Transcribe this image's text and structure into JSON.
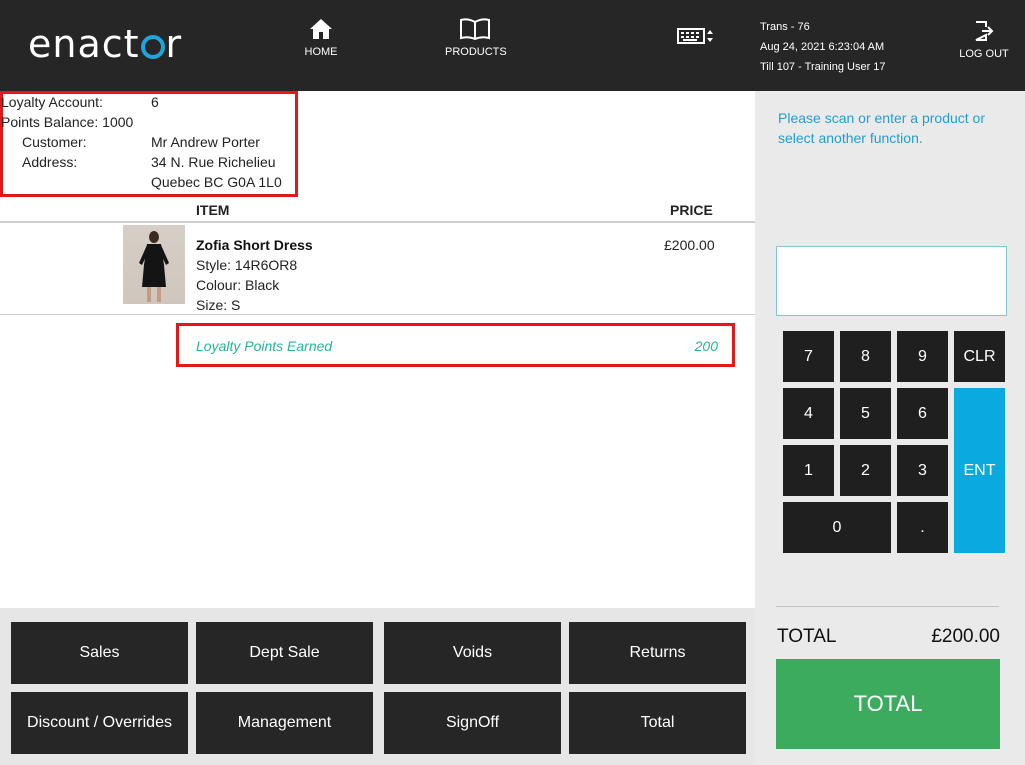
{
  "header": {
    "logo": "enactor",
    "nav": [
      {
        "label": "HOME",
        "icon": "home-icon"
      },
      {
        "label": "PRODUCTS",
        "icon": "book-icon"
      }
    ],
    "trans_info": {
      "trans": "Trans - 76",
      "datetime": "Aug 24, 2021 6:23:04 AM",
      "till": "Till 107 - Training User 17"
    },
    "logout_label": "LOG OUT"
  },
  "customer": {
    "loyalty_account_label": "Loyalty Account:",
    "loyalty_account_value": "6",
    "points_balance": "Points Balance: 1000",
    "customer_label": "Customer:",
    "customer_value": "Mr Andrew Porter",
    "address_label": "Address:",
    "address_line1": "34 N. Rue Richelieu",
    "address_line2": "Quebec BC G0A 1L0"
  },
  "basket": {
    "col_item": "ITEM",
    "col_price": "PRICE",
    "items": [
      {
        "name": "Zofia Short Dress",
        "style": "Style: 14R6OR8",
        "colour": "Colour: Black",
        "size": "Size: S",
        "price": "£200.00"
      }
    ],
    "loyalty_label": "Loyalty Points Earned",
    "loyalty_value": "200"
  },
  "functions": [
    "Sales",
    "Dept Sale",
    "Voids",
    "Returns",
    "Discount / Overrides",
    "Management",
    "SignOff",
    "Total"
  ],
  "side": {
    "prompt": "Please scan or enter a product or select another function.",
    "keys": {
      "k7": "7",
      "k8": "8",
      "k9": "9",
      "clr": "CLR",
      "k4": "4",
      "k5": "5",
      "k6": "6",
      "k1": "1",
      "k2": "2",
      "k3": "3",
      "k0": "0",
      "dot": ".",
      "ent": "ENT"
    },
    "total_label": "TOTAL",
    "total_amount": "£200.00",
    "total_button": "TOTAL"
  },
  "colors": {
    "topbar": "#262626",
    "accent_blue": "#1e9fd4",
    "ent_key": "#0aa9e0",
    "total_green": "#3dab5d",
    "loyalty_text": "#24b59a",
    "highlight_red": "#e41818"
  }
}
